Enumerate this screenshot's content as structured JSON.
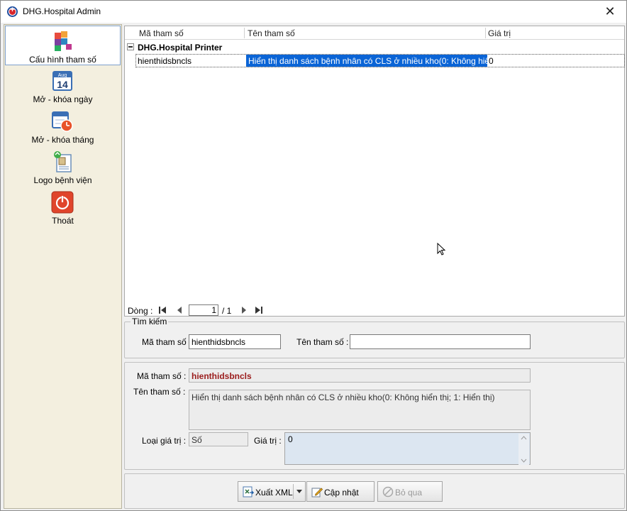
{
  "window": {
    "title": "DHG.Hospital Admin",
    "close": "✕"
  },
  "sidebar": {
    "items": [
      {
        "label": "Cấu hình tham số",
        "icon": "config-blocks-icon",
        "active": true
      },
      {
        "label": "Mở - khóa ngày",
        "icon": "calendar-day-icon",
        "active": false
      },
      {
        "label": "Mở - khóa tháng",
        "icon": "calendar-clock-icon",
        "active": false
      },
      {
        "label": "Logo bệnh viện",
        "icon": "logo-document-icon",
        "active": false
      },
      {
        "label": "Thoát",
        "icon": "power-icon",
        "active": false
      }
    ],
    "calendar_month": "Aug",
    "calendar_day": "14"
  },
  "grid": {
    "columns": [
      "Mã tham số",
      "Tên tham số",
      "Giá trị"
    ],
    "group": "DHG.Hospital Printer",
    "rows": [
      {
        "code": "hienthidsbncls",
        "name": "Hiển thị danh sách bệnh nhân có CLS ở nhiều kho(0: Không hiển...",
        "value": "0"
      }
    ],
    "pager": {
      "label": "Dòng :",
      "page": "1",
      "total": "/ 1"
    }
  },
  "search": {
    "legend": "Tìm kiếm",
    "code_label": "Mã tham số :",
    "code_value": "hienthidsbncls",
    "name_label": "Tên tham số :",
    "name_value": ""
  },
  "detail": {
    "code_label": "Mã tham số :",
    "code_value": "hienthidsbncls",
    "name_label": "Tên tham số :",
    "name_value": "Hiển thị danh sách bệnh nhân có CLS ở nhiều kho(0: Không hiển thị; 1: Hiển thị)",
    "type_label": "Loại giá trị :",
    "type_value": "Số",
    "value_label": "Giá trị :",
    "value_value": "0"
  },
  "actions": {
    "export": "Xuất XML",
    "update": "Cập nhật",
    "skip": "Bỏ qua"
  },
  "colors": {
    "accent": "#0a64d6",
    "sidebar_bg": "#f3efdf",
    "code_text": "#9b1c1c",
    "value_bg": "#dce6f1"
  }
}
